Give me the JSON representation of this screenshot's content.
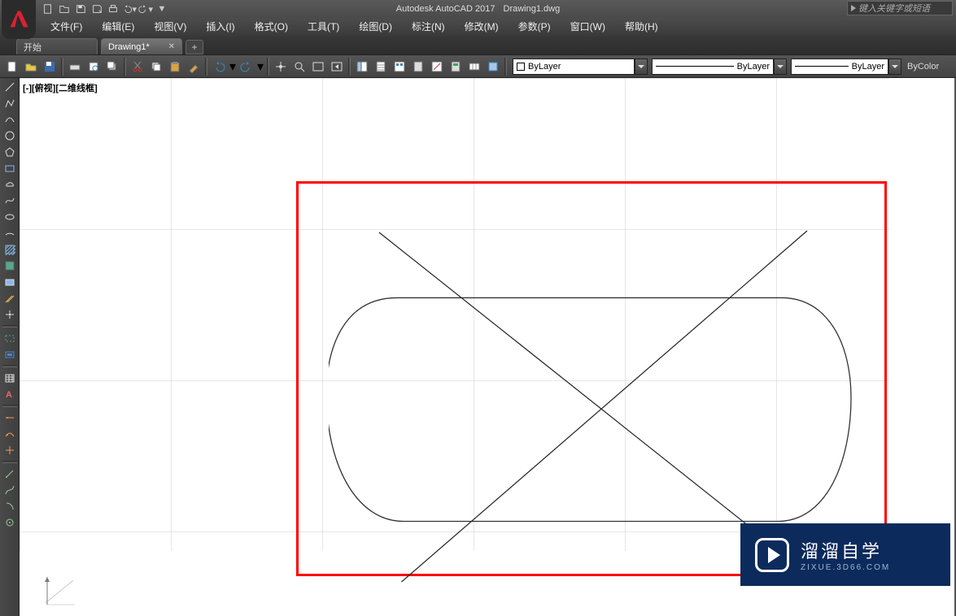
{
  "title": {
    "app": "Autodesk AutoCAD 2017",
    "file": "Drawing1.dwg"
  },
  "search": {
    "placeholder": "键入关键字或短语"
  },
  "qat_icons": [
    "new",
    "open",
    "save",
    "saveas",
    "plot",
    "undo",
    "redo"
  ],
  "menu": [
    {
      "label": "文件(F)"
    },
    {
      "label": "编辑(E)"
    },
    {
      "label": "视图(V)"
    },
    {
      "label": "插入(I)"
    },
    {
      "label": "格式(O)"
    },
    {
      "label": "工具(T)"
    },
    {
      "label": "绘图(D)"
    },
    {
      "label": "标注(N)"
    },
    {
      "label": "修改(M)"
    },
    {
      "label": "参数(P)"
    },
    {
      "label": "窗口(W)"
    },
    {
      "label": "帮助(H)"
    }
  ],
  "tabs": {
    "items": [
      {
        "label": "开始",
        "active": false
      },
      {
        "label": "Drawing1*",
        "active": true
      }
    ]
  },
  "toolbar": {
    "std": [
      "new",
      "open",
      "save",
      "plot",
      "preview",
      "publish"
    ],
    "edit": [
      "cut",
      "copy",
      "paste",
      "match",
      "undo",
      "redo"
    ],
    "nav": [
      "pan",
      "zoom",
      "zoomw",
      "zoomp"
    ],
    "props": [
      "props",
      "sheet",
      "dcenter",
      "tpal",
      "calc",
      "xref",
      "block"
    ]
  },
  "layerctl": {
    "color": "#ffffff",
    "value": "ByLayer",
    "linetype": "ByLayer",
    "lineweight": "ByLayer",
    "plotstyle": "ByColor"
  },
  "leftbox": [
    "line",
    "pline",
    "arc",
    "circle",
    "rect",
    "polygon",
    "rect2",
    "cloud",
    "spline",
    "ellipse",
    "earc",
    "hatch",
    "gradient",
    "region",
    "ray",
    "point",
    "sep",
    "dimextents",
    "dimwindow",
    "sep",
    "table",
    "text",
    "sep",
    "blend1",
    "blend2",
    "blend3",
    "sep",
    "m1",
    "m2",
    "m3",
    "m4"
  ],
  "viewport": {
    "label": "[-][俯视][二维线框]"
  },
  "watermark": {
    "cn": "溜溜自学",
    "en": "ZIXUE.3D66.COM"
  }
}
